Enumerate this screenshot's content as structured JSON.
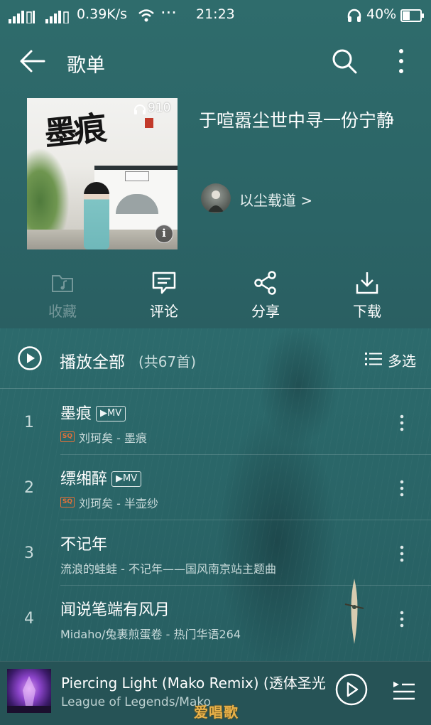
{
  "status_bar": {
    "speed": "0.39K/s",
    "dots": "···",
    "time": "21:23",
    "battery": "40%"
  },
  "toolbar": {
    "title": "歌单"
  },
  "playlist": {
    "name": "于喧嚣尘世中寻一份宁静",
    "cover_title": "墨痕",
    "play_count": "910",
    "creator": "以尘载道 >"
  },
  "actions": [
    {
      "label": "收藏",
      "enabled": false
    },
    {
      "label": "评论",
      "enabled": true
    },
    {
      "label": "分享",
      "enabled": true
    },
    {
      "label": "下载",
      "enabled": true
    }
  ],
  "play_all": {
    "label": "播放全部",
    "count": "(共67首)",
    "multiselect": "多选"
  },
  "songs": [
    {
      "index": "1",
      "title": "墨痕",
      "mv": "▶MV",
      "sq": "SQ",
      "subtitle": "刘珂矣 - 墨痕"
    },
    {
      "index": "2",
      "title": "缥缃醉",
      "mv": "▶MV",
      "sq": "SQ",
      "subtitle": "刘珂矣 - 半壶纱"
    },
    {
      "index": "3",
      "title": "不记年",
      "subtitle": "流浪的蛙蛙 - 不记年——国风南京站主题曲"
    },
    {
      "index": "4",
      "title": "闻说笔端有风月",
      "subtitle": "Midaho/兔裹煎蛋卷 - 热门华语264"
    }
  ],
  "now_playing": {
    "title": "Piercing Light (Mako Remix) (透体圣光",
    "artist": "League of Legends/Mako"
  },
  "watermark": "爱唱歌",
  "colors": {
    "accent_sq": "#e0713a",
    "background": "#2b6466"
  }
}
